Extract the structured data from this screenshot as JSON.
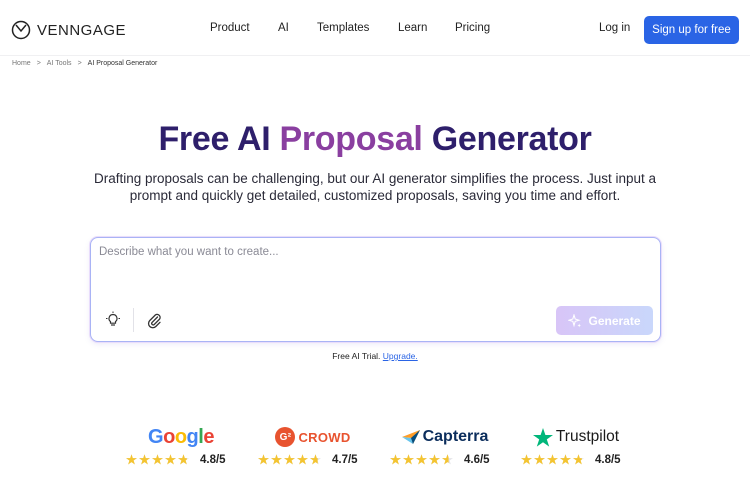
{
  "header": {
    "brand": "VENNGAGE",
    "nav": [
      "Product",
      "AI",
      "Templates",
      "Learn",
      "Pricing"
    ],
    "login": "Log in",
    "signup": "Sign up for free",
    "signup_color": "#2a64e5"
  },
  "breadcrumb": {
    "items": [
      "Home",
      "AI Tools",
      "AI Proposal Generator"
    ],
    "separator": ">"
  },
  "hero": {
    "title_part1": "Free AI ",
    "title_accent": "Proposal",
    "title_part2": " Generator",
    "title_color": "#2e1f6b",
    "accent_color": "#8a3fa0",
    "subtitle": "Drafting proposals can be challenging, but our AI generator simplifies the process. Just input a prompt and quickly get detailed, customized proposals, saving you time and effort."
  },
  "prompt": {
    "placeholder": "Describe what you want to create...",
    "value": "",
    "generate_label": "Generate",
    "idea_icon": "lightbulb-icon",
    "attach_icon": "paperclip-icon"
  },
  "trial": {
    "text": "Free AI Trial.",
    "link": "Upgrade."
  },
  "ratings": [
    {
      "brand": "Google",
      "score": "4.8/5",
      "stars": 4.8
    },
    {
      "brand": "CROWD",
      "score": "4.7/5",
      "stars": 4.7
    },
    {
      "brand": "Capterra",
      "score": "4.6/5",
      "stars": 4.6
    },
    {
      "brand": "Trustpilot",
      "score": "4.8/5",
      "stars": 4.8
    }
  ],
  "star_color": "#f4c430"
}
